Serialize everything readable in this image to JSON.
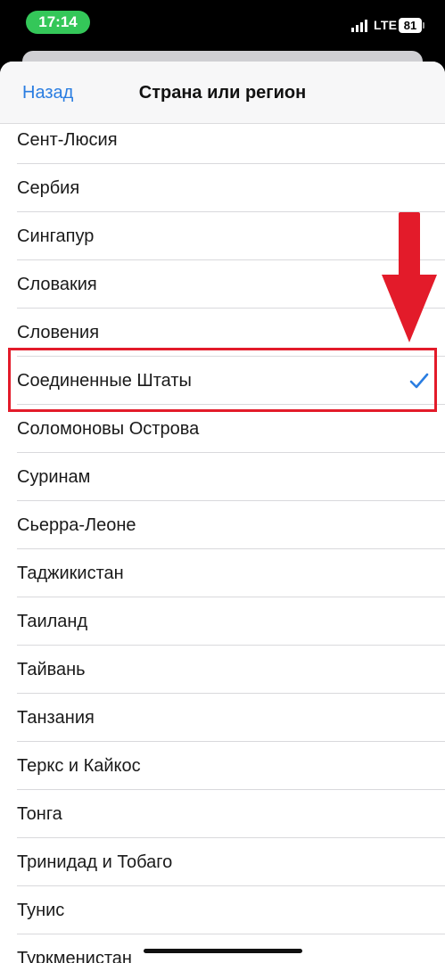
{
  "status_bar": {
    "time": "17:14",
    "network": "LTE",
    "battery": "81"
  },
  "nav": {
    "back_label": "Назад",
    "title": "Страна или регион"
  },
  "countries": [
    {
      "label": "Сент-Люсия",
      "selected": false
    },
    {
      "label": "Сербия",
      "selected": false
    },
    {
      "label": "Сингапур",
      "selected": false
    },
    {
      "label": "Словакия",
      "selected": false
    },
    {
      "label": "Словения",
      "selected": false
    },
    {
      "label": "Соединенные Штаты",
      "selected": true
    },
    {
      "label": "Соломоновы Острова",
      "selected": false
    },
    {
      "label": "Суринам",
      "selected": false
    },
    {
      "label": "Сьерра-Леоне",
      "selected": false
    },
    {
      "label": "Таджикистан",
      "selected": false
    },
    {
      "label": "Таиланд",
      "selected": false
    },
    {
      "label": "Тайвань",
      "selected": false
    },
    {
      "label": "Танзания",
      "selected": false
    },
    {
      "label": "Теркс и Кайкос",
      "selected": false
    },
    {
      "label": "Тонга",
      "selected": false
    },
    {
      "label": "Тринидад и Тобаго",
      "selected": false
    },
    {
      "label": "Тунис",
      "selected": false
    },
    {
      "label": "Туркменистан",
      "selected": false
    }
  ],
  "colors": {
    "accent": "#2a7de1",
    "highlight": "#e31b2a",
    "time_pill": "#34c759"
  },
  "icons": {
    "check": "check-icon",
    "annotation_arrow": "arrow-down-icon"
  }
}
